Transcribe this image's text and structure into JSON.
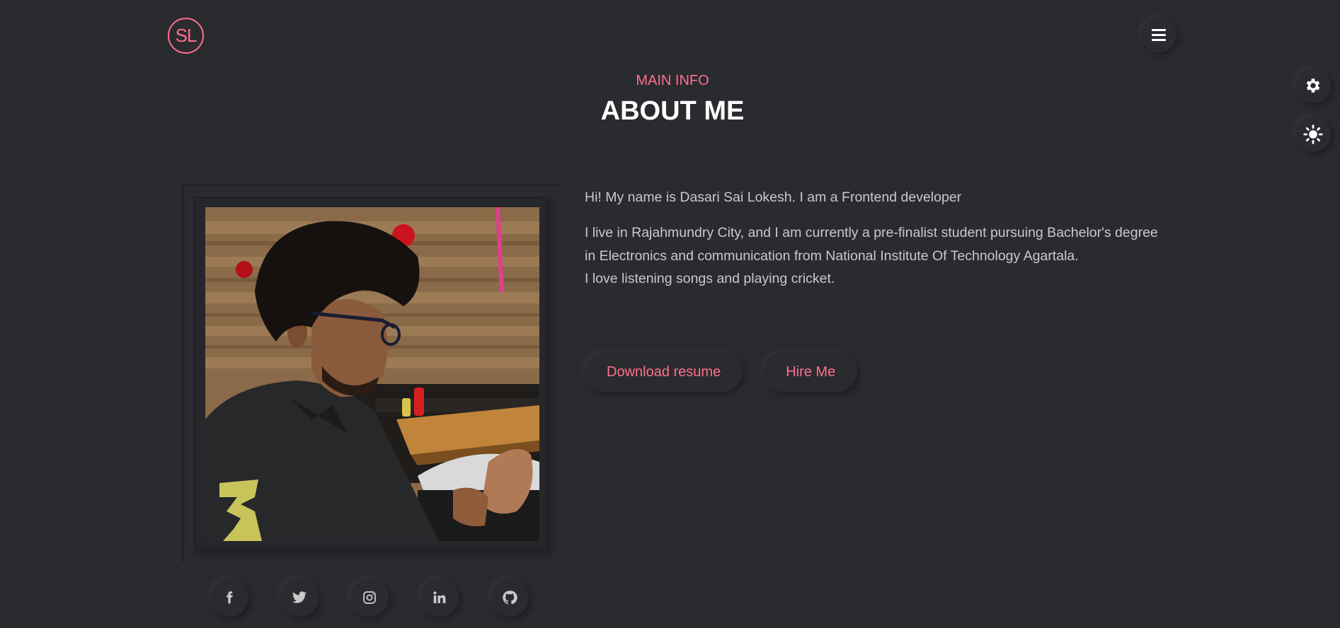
{
  "header": {
    "logo_text": "SL",
    "menu_icon": "hamburger-icon"
  },
  "floating": {
    "settings_icon": "gear-icon",
    "theme_icon": "sun-icon"
  },
  "section": {
    "subtitle": "MAIN INFO",
    "title": "ABOUT ME"
  },
  "about": {
    "intro": "Hi! My name is Dasari Sai Lokesh. I am a Frontend developer",
    "bio_line1": "I live in Rajahmundry City, and I am currently a pre-finalist student pursuing Bachelor's degree in Electronics and communication from National Institute Of Technology Agartala.",
    "bio_line2": "I love listening songs and playing cricket."
  },
  "buttons": {
    "download": "Download resume",
    "hire": "Hire Me"
  },
  "socials": [
    "facebook-icon",
    "twitter-icon",
    "instagram-icon",
    "linkedin-icon",
    "github-icon"
  ],
  "colors": {
    "accent": "#ff6f8f",
    "background": "#2a2b2f",
    "text": "#c9c9c9",
    "heading": "#ffffff"
  }
}
